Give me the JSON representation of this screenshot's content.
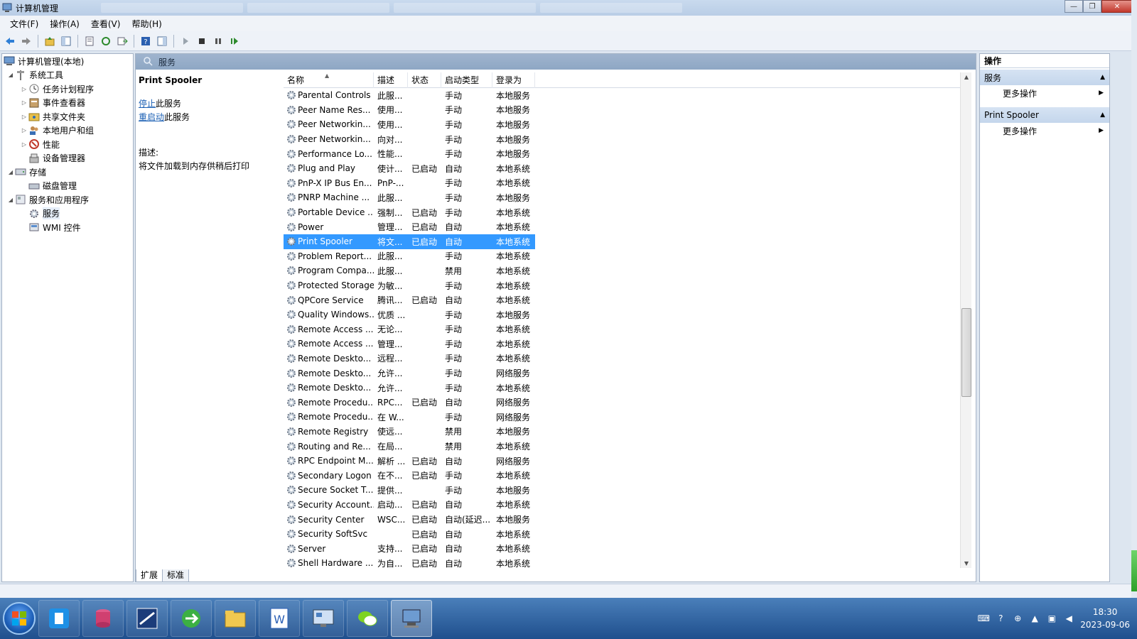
{
  "window": {
    "title": "计算机管理"
  },
  "menu": [
    "文件(F)",
    "操作(A)",
    "查看(V)",
    "帮助(H)"
  ],
  "tree": {
    "root": "计算机管理(本地)",
    "system_tools": "系统工具",
    "task_scheduler": "任务计划程序",
    "event_viewer": "事件查看器",
    "shared_folders": "共享文件夹",
    "local_users": "本地用户和组",
    "performance": "性能",
    "device_manager": "设备管理器",
    "storage": "存储",
    "disk_management": "磁盘管理",
    "services_apps": "服务和应用程序",
    "services": "服务",
    "wmi": "WMI 控件"
  },
  "center": {
    "header": "服务",
    "detail": {
      "service_name": "Print Spooler",
      "stop_link": "停止",
      "stop_suffix": "此服务",
      "restart_link": "重启动",
      "restart_suffix": "此服务",
      "desc_label": "描述:",
      "desc_text": "将文件加载到内存供稍后打印"
    },
    "columns": {
      "name": "名称",
      "desc": "描述",
      "status": "状态",
      "start": "启动类型",
      "logon": "登录为"
    },
    "tabs": {
      "extended": "扩展",
      "standard": "标准"
    }
  },
  "services": [
    {
      "name": "Parental Controls",
      "desc": "此服...",
      "status": "",
      "start": "手动",
      "logon": "本地服务"
    },
    {
      "name": "Peer Name Res...",
      "desc": "使用...",
      "status": "",
      "start": "手动",
      "logon": "本地服务"
    },
    {
      "name": "Peer Networkin...",
      "desc": "使用...",
      "status": "",
      "start": "手动",
      "logon": "本地服务"
    },
    {
      "name": "Peer Networkin...",
      "desc": "向对...",
      "status": "",
      "start": "手动",
      "logon": "本地服务"
    },
    {
      "name": "Performance Lo...",
      "desc": "性能...",
      "status": "",
      "start": "手动",
      "logon": "本地服务"
    },
    {
      "name": "Plug and Play",
      "desc": "使计...",
      "status": "已启动",
      "start": "自动",
      "logon": "本地系统"
    },
    {
      "name": "PnP-X IP Bus En...",
      "desc": "PnP-...",
      "status": "",
      "start": "手动",
      "logon": "本地系统"
    },
    {
      "name": "PNRP Machine ...",
      "desc": "此服...",
      "status": "",
      "start": "手动",
      "logon": "本地服务"
    },
    {
      "name": "Portable Device ...",
      "desc": "强制...",
      "status": "已启动",
      "start": "手动",
      "logon": "本地系统"
    },
    {
      "name": "Power",
      "desc": "管理...",
      "status": "已启动",
      "start": "自动",
      "logon": "本地系统"
    },
    {
      "name": "Print Spooler",
      "desc": "将文...",
      "status": "已启动",
      "start": "自动",
      "logon": "本地系统",
      "selected": true
    },
    {
      "name": "Problem Report...",
      "desc": "此服...",
      "status": "",
      "start": "手动",
      "logon": "本地系统"
    },
    {
      "name": "Program Compa...",
      "desc": "此服...",
      "status": "",
      "start": "禁用",
      "logon": "本地系统"
    },
    {
      "name": "Protected Storage",
      "desc": "为敏...",
      "status": "",
      "start": "手动",
      "logon": "本地系统"
    },
    {
      "name": "QPCore Service",
      "desc": "腾讯...",
      "status": "已启动",
      "start": "自动",
      "logon": "本地系统"
    },
    {
      "name": "Quality Windows...",
      "desc": "优质 ...",
      "status": "",
      "start": "手动",
      "logon": "本地服务"
    },
    {
      "name": "Remote Access ...",
      "desc": "无论...",
      "status": "",
      "start": "手动",
      "logon": "本地系统"
    },
    {
      "name": "Remote Access ...",
      "desc": "管理...",
      "status": "",
      "start": "手动",
      "logon": "本地系统"
    },
    {
      "name": "Remote Deskto...",
      "desc": "远程...",
      "status": "",
      "start": "手动",
      "logon": "本地系统"
    },
    {
      "name": "Remote Deskto...",
      "desc": "允许...",
      "status": "",
      "start": "手动",
      "logon": "网络服务"
    },
    {
      "name": "Remote Deskto...",
      "desc": "允许...",
      "status": "",
      "start": "手动",
      "logon": "本地系统"
    },
    {
      "name": "Remote Procedu...",
      "desc": "RPC...",
      "status": "已启动",
      "start": "自动",
      "logon": "网络服务"
    },
    {
      "name": "Remote Procedu...",
      "desc": "在 W...",
      "status": "",
      "start": "手动",
      "logon": "网络服务"
    },
    {
      "name": "Remote Registry",
      "desc": "使远...",
      "status": "",
      "start": "禁用",
      "logon": "本地服务"
    },
    {
      "name": "Routing and Re...",
      "desc": "在局...",
      "status": "",
      "start": "禁用",
      "logon": "本地系统"
    },
    {
      "name": "RPC Endpoint M...",
      "desc": "解析 ...",
      "status": "已启动",
      "start": "自动",
      "logon": "网络服务"
    },
    {
      "name": "Secondary Logon",
      "desc": "在不...",
      "status": "已启动",
      "start": "手动",
      "logon": "本地系统"
    },
    {
      "name": "Secure Socket T...",
      "desc": "提供...",
      "status": "",
      "start": "手动",
      "logon": "本地服务"
    },
    {
      "name": "Security Account...",
      "desc": "启动...",
      "status": "已启动",
      "start": "自动",
      "logon": "本地系统"
    },
    {
      "name": "Security Center",
      "desc": "WSC...",
      "status": "已启动",
      "start": "自动(延迟...",
      "logon": "本地服务"
    },
    {
      "name": "Security SoftSvc",
      "desc": "",
      "status": "已启动",
      "start": "自动",
      "logon": "本地系统"
    },
    {
      "name": "Server",
      "desc": "支持...",
      "status": "已启动",
      "start": "自动",
      "logon": "本地系统"
    },
    {
      "name": "Shell Hardware ...",
      "desc": "为自...",
      "status": "已启动",
      "start": "自动",
      "logon": "本地系统"
    }
  ],
  "actions": {
    "title": "操作",
    "section1": "服务",
    "section1_item": "更多操作",
    "section2": "Print Spooler",
    "section2_item": "更多操作"
  },
  "clock": {
    "time": "18:30",
    "date": "2023-09-06"
  },
  "colors": {
    "selection": "#3399ff",
    "link": "#1a5fb4",
    "taskbar": "#1f4f8d"
  }
}
